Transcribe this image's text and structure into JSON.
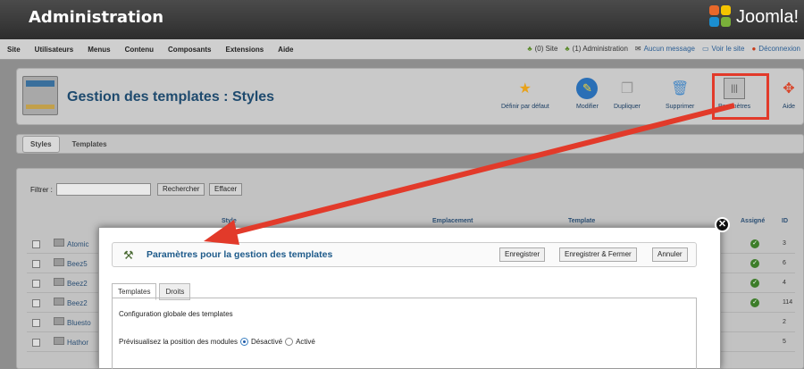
{
  "topbar": {
    "title": "Administration",
    "brand": "Joomla!"
  },
  "menubar": {
    "items": [
      "Site",
      "Utilisateurs",
      "Menus",
      "Contenu",
      "Composants",
      "Extensions",
      "Aide"
    ],
    "status": {
      "site": "(0) Site",
      "admin": "(1) Administration",
      "messages": "Aucun message",
      "view_site": "Voir le site",
      "logout": "Déconnexion"
    }
  },
  "toolbar": {
    "page_title": "Gestion des templates : Styles",
    "default_label": "Définir par défaut",
    "edit_label": "Modifier",
    "duplicate_label": "Dupliquer",
    "delete_label": "Supprimer",
    "params_label": "Paramètres",
    "help_label": "Aide"
  },
  "tabs": {
    "styles": "Styles",
    "templates": "Templates"
  },
  "filter": {
    "label": "Filtrer :",
    "search": "Rechercher",
    "clear": "Effacer"
  },
  "columns": {
    "style": "Style",
    "location": "Emplacement",
    "template": "Template",
    "assigned": "Assigné",
    "id": "ID"
  },
  "rows": [
    {
      "name": "Atomic",
      "id": "3",
      "assigned": true
    },
    {
      "name": "Beez5",
      "id": "6",
      "assigned": true
    },
    {
      "name": "Beez2",
      "id": "4",
      "assigned": true
    },
    {
      "name": "Beez2",
      "id": "114",
      "assigned": true
    },
    {
      "name": "Bluesto",
      "id": "2",
      "assigned": false
    },
    {
      "name": "Hathor",
      "id": "5",
      "assigned": false
    }
  ],
  "modal": {
    "title": "Paramètres pour la gestion des templates",
    "save": "Enregistrer",
    "save_close": "Enregistrer & Fermer",
    "cancel": "Annuler",
    "tab_templates": "Templates",
    "tab_rights": "Droits",
    "section_label": "Configuration globale des templates",
    "preview_label": "Prévisualisez la position des modules",
    "opt_off": "Désactivé",
    "opt_on": "Activé",
    "selected": "Désactivé"
  },
  "colors": {
    "highlight": "#e23a2a",
    "title_blue": "#1d5a8a",
    "header_dark": "#2d2d2d"
  }
}
